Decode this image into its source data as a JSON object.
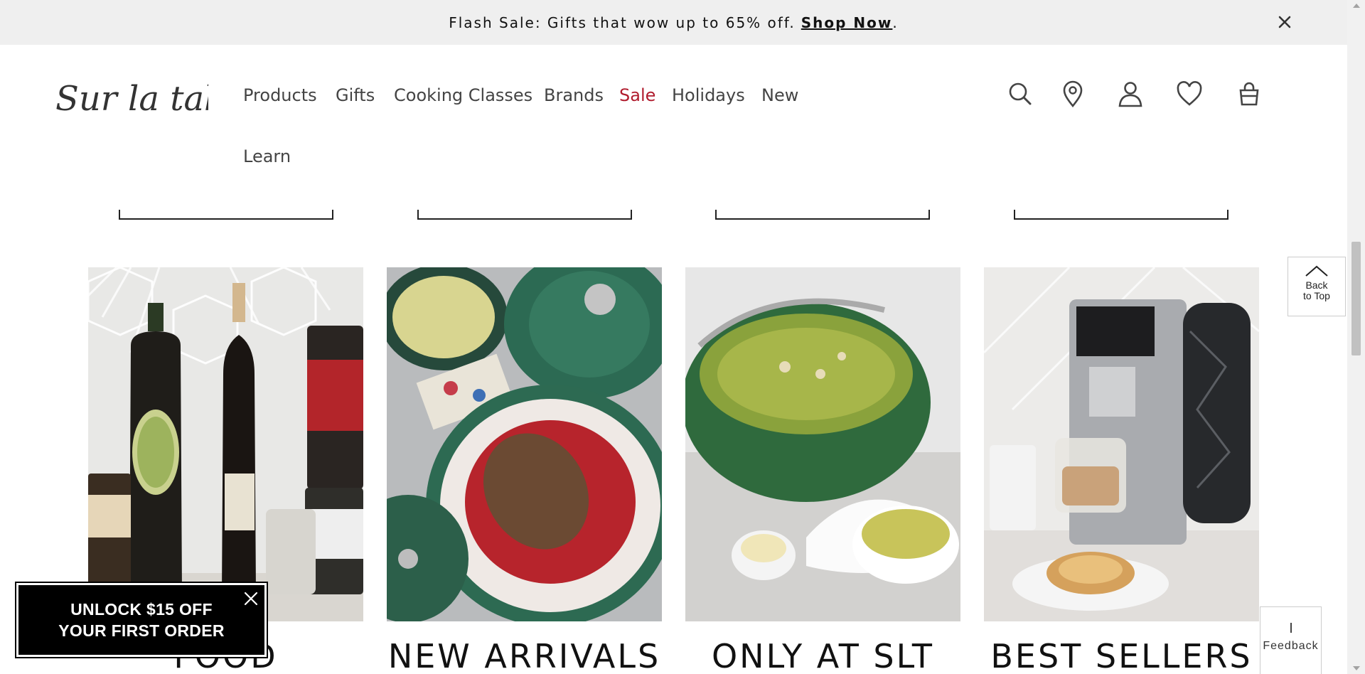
{
  "flash_bar": {
    "text": "Flash Sale: Gifts that wow up to 65% off.",
    "link_label": "Shop Now",
    "suffix": ".",
    "close_icon": "close-icon"
  },
  "header": {
    "logo_text": "Sur la table",
    "nav": [
      {
        "label": "Products"
      },
      {
        "label": "Gifts"
      },
      {
        "label": "Cooking Classes"
      },
      {
        "label": "Brands"
      },
      {
        "label": "Sale"
      },
      {
        "label": "Holidays"
      },
      {
        "label": "New"
      },
      {
        "label": "Learn"
      }
    ],
    "icons": [
      "search-icon",
      "store-location-icon",
      "account-icon",
      "wishlist-heart-icon",
      "shopping-bag-icon"
    ]
  },
  "tiles": [
    {
      "title": "FOOD",
      "image": "pantry-oils-vinegars-spices"
    },
    {
      "title": "NEW ARRIVALS",
      "image": "green-cookware-pork-dish"
    },
    {
      "title": "ONLY AT SLT",
      "image": "green-dutch-oven-soup"
    },
    {
      "title": "BEST SELLERS",
      "image": "espresso-machine-latte"
    }
  ],
  "back_to_top": {
    "line1": "Back",
    "line2": "to Top"
  },
  "feedback": {
    "label": "Feedback"
  },
  "promo": {
    "line1": "UNLOCK $15 OFF",
    "line2": "YOUR FIRST ORDER"
  },
  "colors": {
    "sale": "#b01c2e",
    "flash_bg": "#efefef",
    "promo_bg": "#000000"
  }
}
